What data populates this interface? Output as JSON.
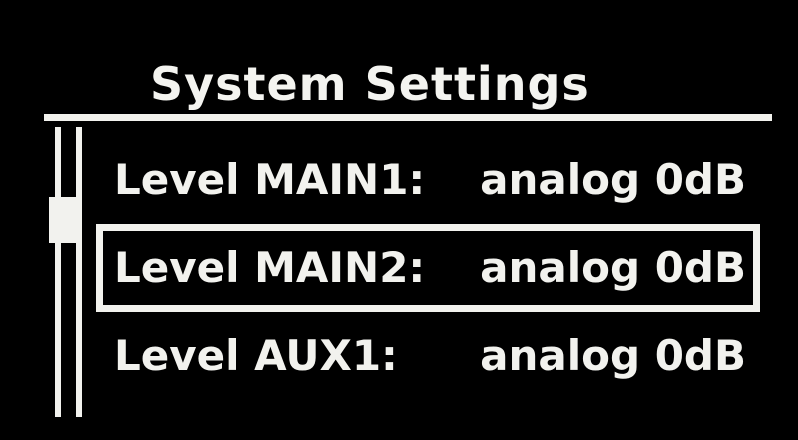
{
  "header": {
    "title": "System Settings"
  },
  "settings": {
    "items": [
      {
        "label": "Level MAIN1:",
        "value": "analog 0dB",
        "selected": false
      },
      {
        "label": "Level MAIN2:",
        "value": "analog 0dB",
        "selected": true
      },
      {
        "label": "Level AUX1:",
        "value": "analog 0dB",
        "selected": false
      }
    ]
  },
  "scrollbar": {
    "position_fraction": 0.25
  },
  "colors": {
    "background": "#000000",
    "foreground": "#f2f2ee"
  }
}
